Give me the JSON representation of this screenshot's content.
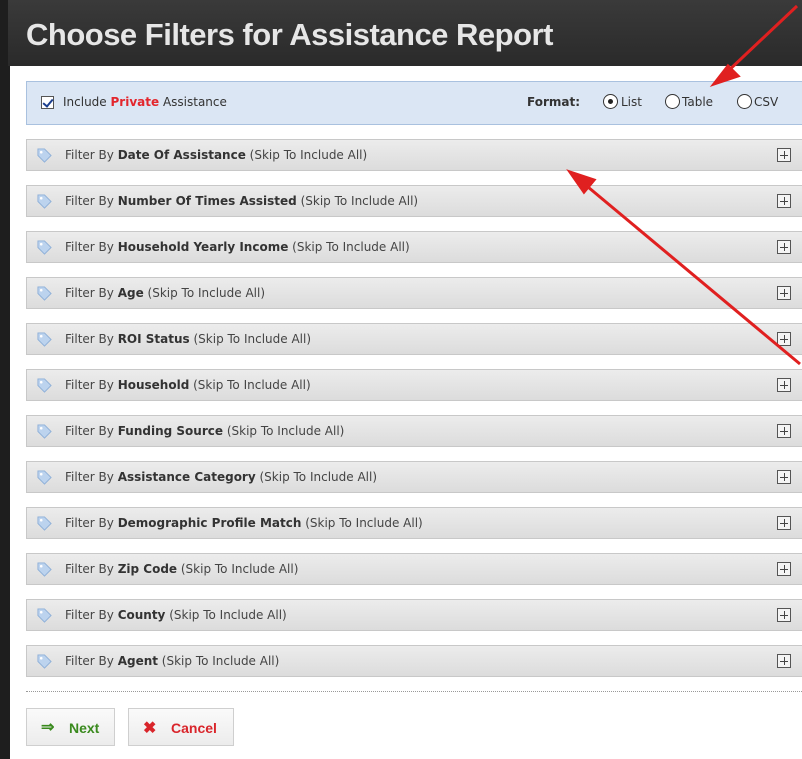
{
  "title": "Choose Filters for Assistance Report",
  "include": {
    "prefix": "Include ",
    "highlight": "Private",
    "suffix": " Assistance",
    "checked": true
  },
  "format": {
    "label": "Format:",
    "options": [
      "List",
      "Table",
      "CSV"
    ],
    "selected": "List"
  },
  "filters": [
    {
      "prefix": "Filter By ",
      "name": "Date Of Assistance",
      "suffix": " (Skip To Include All)"
    },
    {
      "prefix": "Filter By ",
      "name": "Number Of Times Assisted",
      "suffix": " (Skip To Include All)"
    },
    {
      "prefix": "Filter By ",
      "name": "Household Yearly Income",
      "suffix": " (Skip To Include All)"
    },
    {
      "prefix": "Filter By ",
      "name": "Age",
      "suffix": " (Skip To Include All)"
    },
    {
      "prefix": "Filter By ",
      "name": "ROI Status",
      "suffix": " (Skip To Include All)"
    },
    {
      "prefix": "Filter By ",
      "name": "Household",
      "suffix": " (Skip To Include All)"
    },
    {
      "prefix": "Filter By ",
      "name": "Funding Source",
      "suffix": " (Skip To Include All)"
    },
    {
      "prefix": "Filter By ",
      "name": "Assistance Category",
      "suffix": " (Skip To Include All)"
    },
    {
      "prefix": "Filter By ",
      "name": "Demographic Profile Match",
      "suffix": " (Skip To Include All)"
    },
    {
      "prefix": "Filter By ",
      "name": "Zip Code",
      "suffix": " (Skip To Include All)"
    },
    {
      "prefix": "Filter By ",
      "name": "County",
      "suffix": " (Skip To Include All)"
    },
    {
      "prefix": "Filter By ",
      "name": "Agent",
      "suffix": " (Skip To Include All)"
    }
  ],
  "buttons": {
    "next": "Next",
    "cancel": "Cancel"
  },
  "icons": {
    "filter": "tag-icon",
    "expand": "plus-box-icon",
    "next": "arrow-right-icon",
    "cancel": "x-icon"
  },
  "colors": {
    "accent_red": "#e3262d",
    "next_green": "#3a8a1e",
    "cancel_red": "#d9252b"
  }
}
